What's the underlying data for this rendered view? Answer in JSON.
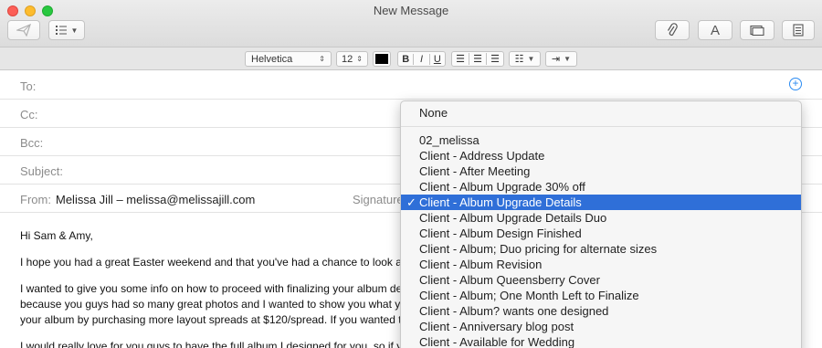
{
  "window": {
    "title": "New Message"
  },
  "toolbar": {
    "send_icon": "paper-plane-icon",
    "header_fields_icon": "list-icon",
    "attach_icon": "paperclip-icon",
    "format_label": "A",
    "photo_browser_icon": "photo-browser-icon",
    "template_icon": "stationery-icon"
  },
  "formatbar": {
    "font": "Helvetica",
    "size": "12",
    "bold": "B",
    "italic": "I",
    "underline": "U"
  },
  "header": {
    "to_label": "To:",
    "cc_label": "Cc:",
    "bcc_label": "Bcc:",
    "subject_label": "Subject:",
    "from_label": "From:",
    "from_value": "Melissa Jill – melissa@melissajill.com",
    "signature_label": "Signature"
  },
  "body": {
    "greeting": "Hi Sam & Amy,",
    "line1": "I hope you had a great Easter weekend and that you've had a chance to look at you",
    "line2a": "I wanted to give you some info on how to proceed with finalizing your album design.",
    "line2b": "because you guys had so many great photos and I wanted to show you what your al",
    "line2c": "your album by purchasing more layout spreads at $120/spread. If you wanted to pur",
    "line3": "I would really love for you guys to have the full album I designed for you, so if you pl"
  },
  "dropdown": {
    "none_label": "None",
    "items": [
      "02_melissa",
      "Client - Address Update",
      "Client - After Meeting",
      "Client - Album Upgrade 30% off",
      "Client - Album Upgrade Details",
      "Client - Album Upgrade Details Duo",
      "Client - Album Design Finished",
      "Client - Album; Duo pricing for alternate sizes",
      "Client - Album Revision",
      "Client - Album Queensberry Cover",
      "Client - Album; One Month Left to Finalize",
      "Client - Album? wants one designed",
      "Client - Anniversary blog post",
      "Client - Available for Wedding"
    ],
    "selected_index": 4,
    "check_mark": "✓"
  }
}
